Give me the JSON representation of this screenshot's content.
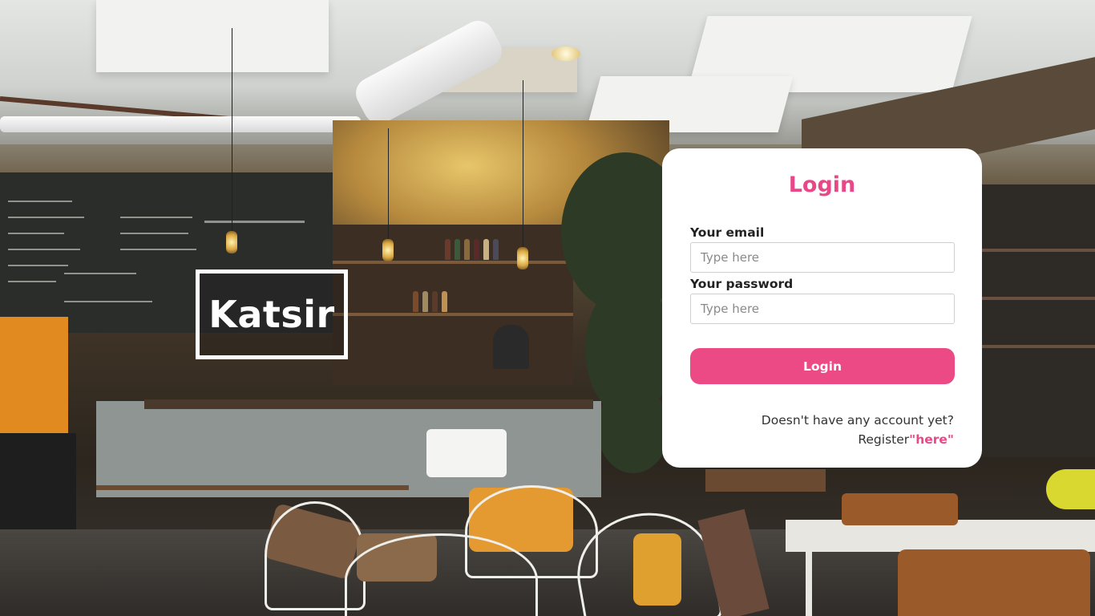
{
  "brand": {
    "logo_text": "Katsir"
  },
  "login_card": {
    "title": "Login",
    "email": {
      "label": "Your email",
      "placeholder": "Type here",
      "value": ""
    },
    "password": {
      "label": "Your password",
      "placeholder": "Type here",
      "value": ""
    },
    "submit_label": "Login",
    "register_prompt": "Doesn't have any account yet?",
    "register_prefix": "Register",
    "register_link_text": "\"here\""
  },
  "colors": {
    "accent": "#ec4a85",
    "card_background": "#ffffff",
    "logo_border": "#ffffff"
  }
}
